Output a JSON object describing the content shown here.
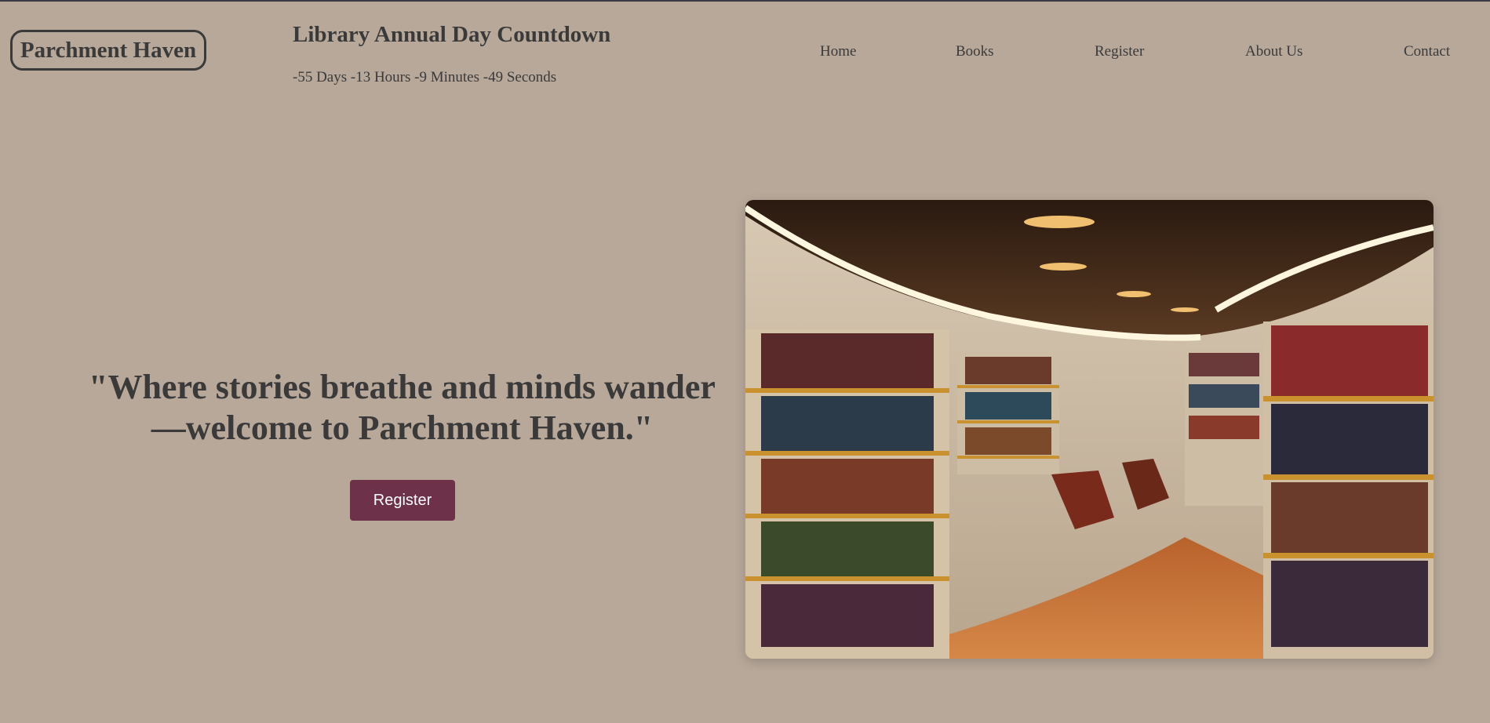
{
  "header": {
    "logo_text": "Parchment Haven",
    "countdown_title": "Library Annual Day Countdown",
    "countdown_value": "-55 Days -13 Hours -9 Minutes -49 Seconds"
  },
  "nav": {
    "items": [
      {
        "label": "Home"
      },
      {
        "label": "Books"
      },
      {
        "label": "Register"
      },
      {
        "label": "About Us"
      },
      {
        "label": "Contact"
      }
    ]
  },
  "hero": {
    "quote_line1": "\"Where stories breathe and minds wander",
    "quote_line2": "—welcome to Parchment Haven.\"",
    "register_label": "Register",
    "image_description_icon": "library-bookshelves-photo"
  },
  "colors": {
    "background": "#b8a89a",
    "text": "#3a3a3a",
    "button": "#6d3249",
    "button_text": "#ffffff"
  }
}
